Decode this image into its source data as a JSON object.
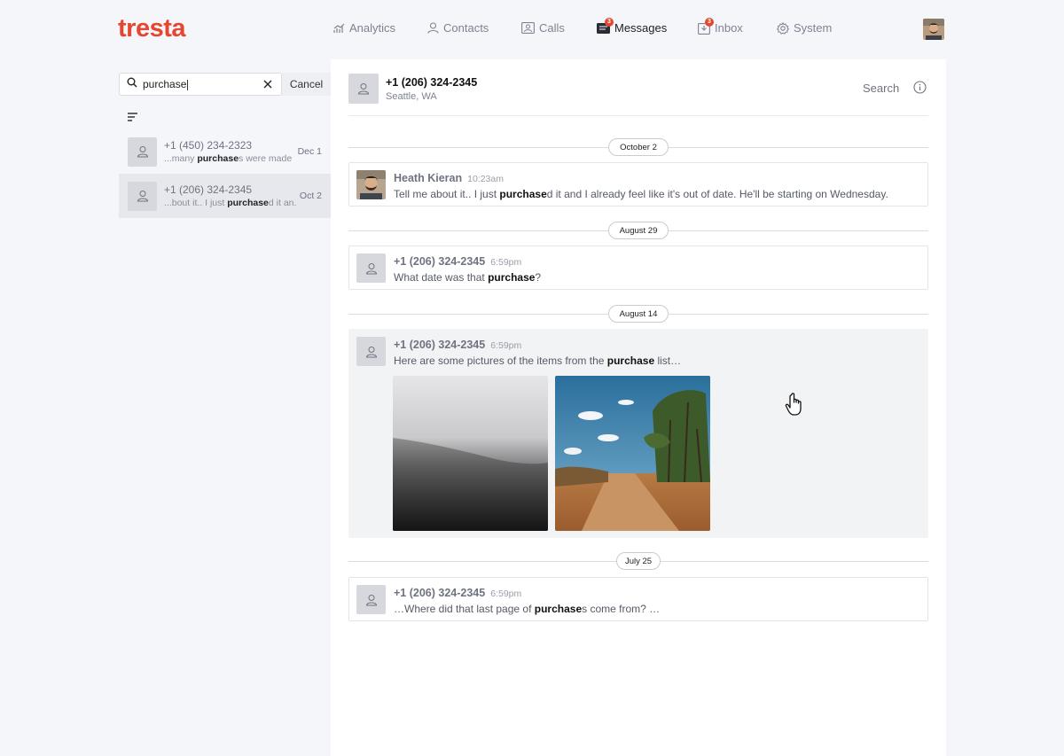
{
  "brand": {
    "logo_text": "tresta",
    "accent_color": "#e5462f"
  },
  "nav": {
    "items": [
      {
        "label": "Analytics",
        "icon": "analytics-icon"
      },
      {
        "label": "Contacts",
        "icon": "contacts-icon"
      },
      {
        "label": "Calls",
        "icon": "calls-icon"
      },
      {
        "label": "Messages",
        "icon": "messages-icon",
        "badge": "3",
        "active": true
      },
      {
        "label": "Inbox",
        "icon": "inbox-icon",
        "badge": "3"
      },
      {
        "label": "System",
        "icon": "gear-icon"
      }
    ]
  },
  "sidebar": {
    "search": {
      "value": "purchase",
      "cancel_label": "Cancel"
    },
    "conversations": [
      {
        "name": "+1 (450) 234-2323",
        "snippet_pre": "...many ",
        "snippet_match": "purchase",
        "snippet_post": "s were made i...",
        "date": "Dec 1",
        "selected": false
      },
      {
        "name": "+1 (206) 324-2345",
        "snippet_pre": "...bout it.. I just ",
        "snippet_match": "purchase",
        "snippet_post": "d it an...",
        "date": "Oct 2",
        "selected": true
      }
    ]
  },
  "conversation": {
    "header": {
      "name": "+1 (206) 324-2345",
      "location": "Seattle, WA",
      "search_label": "Search"
    },
    "date_separators": [
      "October 2",
      "August 29",
      "August 14",
      "July 25"
    ],
    "messages": [
      {
        "sender": "Heath Kieran",
        "time": "10:23am",
        "text_pre": "Tell me about it.. I just ",
        "text_match": "purchase",
        "text_post": "d it and I already feel like it's out of date. He'll be starting on Wednesday."
      },
      {
        "sender": "+1 (206) 324-2345",
        "time": "6:59pm",
        "text_pre": "What date was that ",
        "text_match": "purchase",
        "text_post": "?"
      },
      {
        "sender": "+1 (206) 324-2345",
        "time": "6:59pm",
        "text_pre": "Here are some pictures of the items from the ",
        "text_match": "purchase",
        "text_post": " list…",
        "attachments": [
          "foggy-hill-photo",
          "dirt-road-photo"
        ]
      },
      {
        "sender": "+1 (206) 324-2345",
        "time": "6:59pm",
        "text_pre": "…Where did that last page of ",
        "text_match": "purchase",
        "text_post": "s come from? …"
      }
    ]
  }
}
